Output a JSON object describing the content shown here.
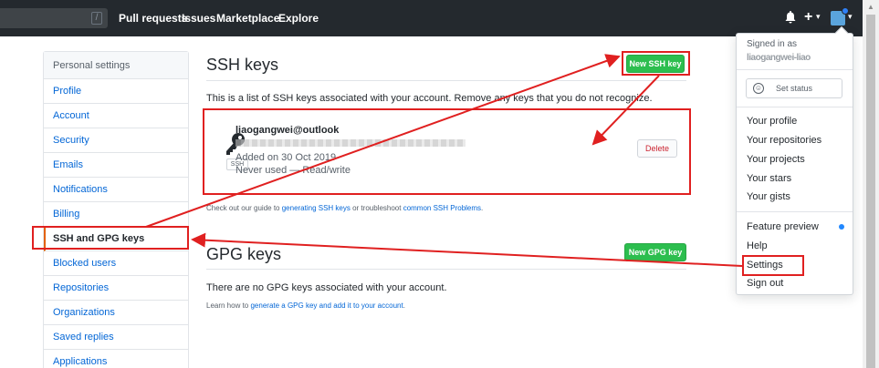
{
  "header": {
    "search_slash": "/",
    "nav": [
      "Pull requests",
      "Issues",
      "Marketplace",
      "Explore"
    ],
    "bell_icon": "bell-icon",
    "plus_label": "+",
    "caret": "▾"
  },
  "sidebar": {
    "heading": "Personal settings",
    "items": [
      "Profile",
      "Account",
      "Security",
      "Emails",
      "Notifications",
      "Billing",
      "SSH and GPG keys",
      "Blocked users",
      "Repositories",
      "Organizations",
      "Saved replies",
      "Applications"
    ],
    "selected": "SSH and GPG keys"
  },
  "ssh": {
    "title": "SSH keys",
    "new_button": "New SSH key",
    "description": "This is a list of SSH keys associated with your account. Remove any keys that you do not recognize.",
    "key": {
      "name": "liaogangwei@outlook",
      "added": "Added on 30 Oct 2019",
      "usage": "Never used — Read/write",
      "badge": "SSH",
      "delete_label": "Delete"
    },
    "guide_prefix": "Check out our guide to ",
    "guide_link1": "generating SSH keys",
    "guide_middle": " or troubleshoot ",
    "guide_link2": "common SSH Problems",
    "guide_suffix": "."
  },
  "gpg": {
    "title": "GPG keys",
    "new_button": "New GPG key",
    "empty": "There are no GPG keys associated with your account.",
    "learn_prefix": "Learn how to ",
    "learn_link": "generate a GPG key and add it to your account",
    "learn_suffix": "."
  },
  "dropdown": {
    "signed_in": "Signed in as",
    "username": "liaogangwei-liao",
    "set_status": "Set status",
    "group1": [
      "Your profile",
      "Your repositories",
      "Your projects",
      "Your stars",
      "Your gists"
    ],
    "feature_preview": "Feature preview",
    "help": "Help",
    "settings": "Settings",
    "sign_out": "Sign out"
  },
  "colors": {
    "header": "#24292e",
    "accent_green": "#2cbe4e",
    "annotation_red": "#e02020",
    "link": "#0366d6"
  }
}
